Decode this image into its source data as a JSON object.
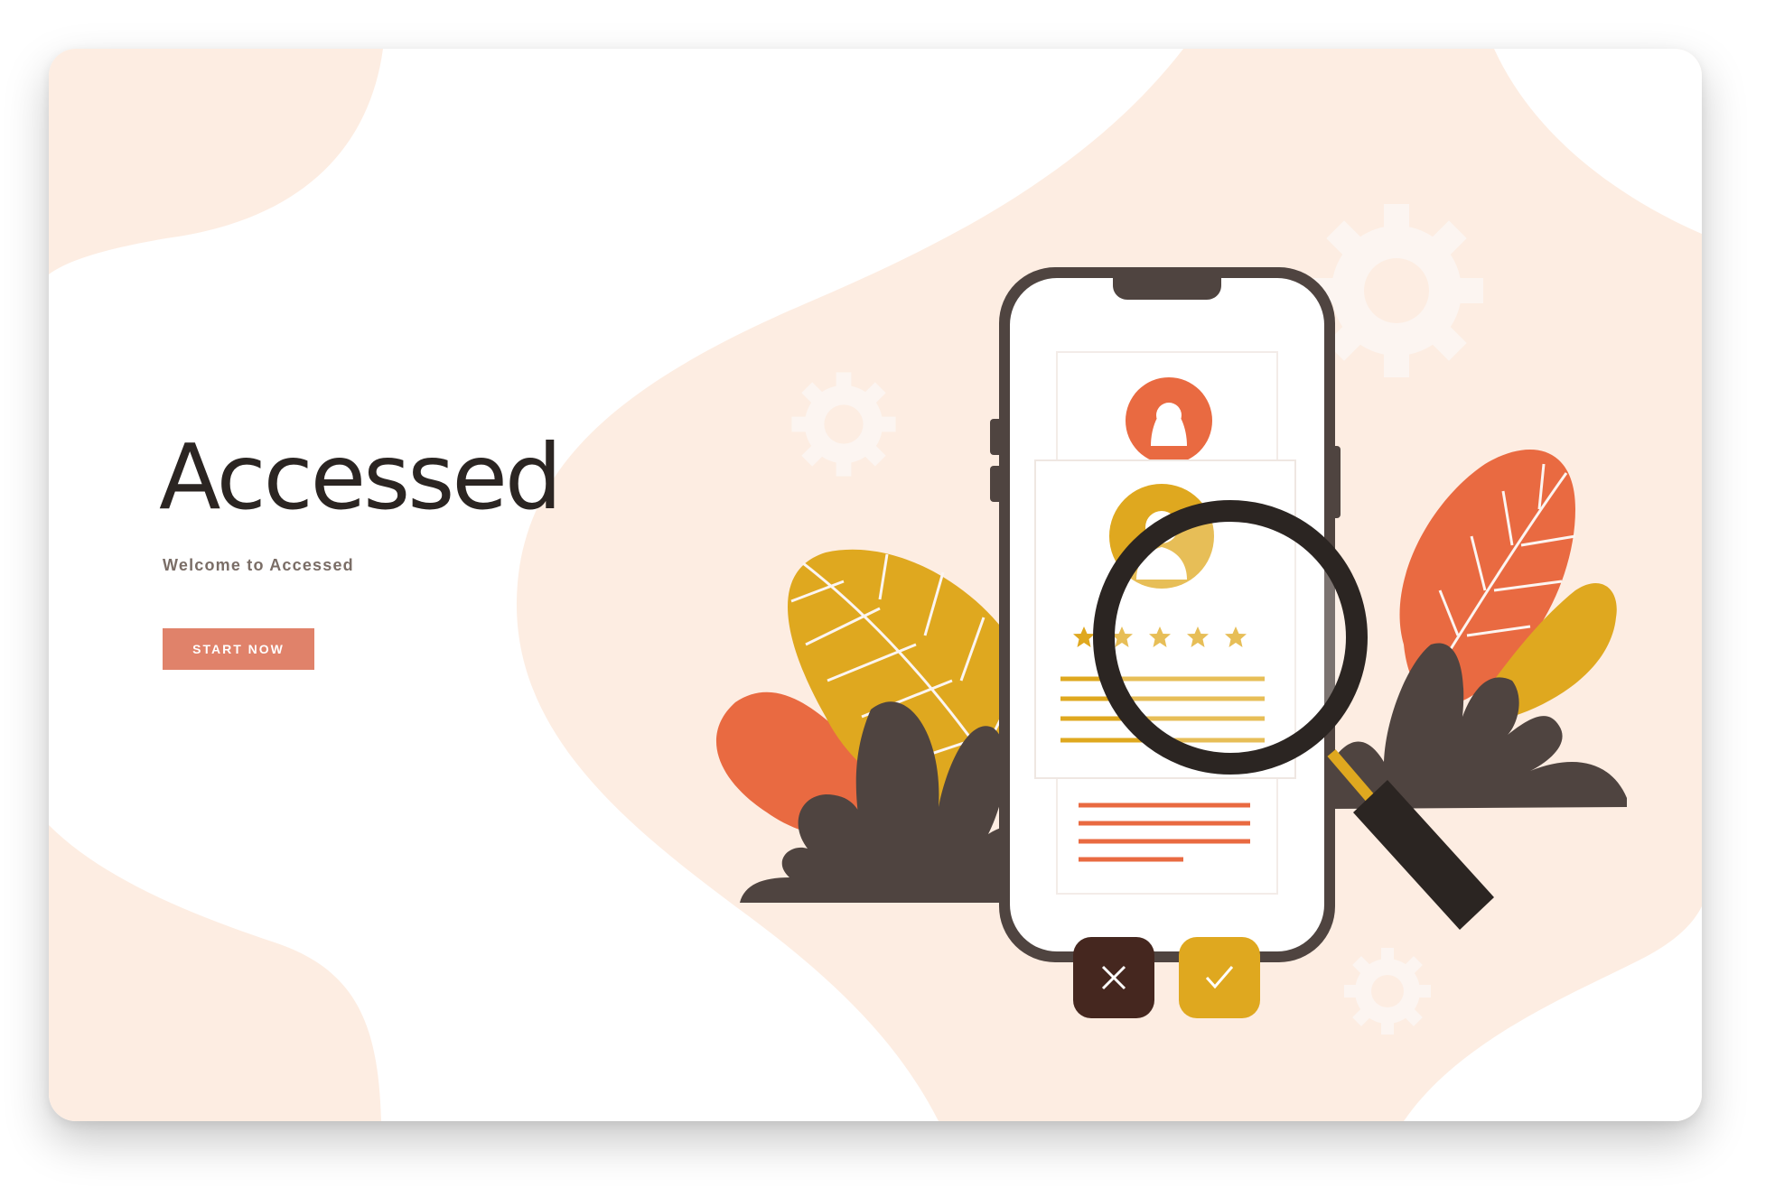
{
  "hero": {
    "title": "Accessed",
    "subtitle": "Welcome to Accessed",
    "cta_label": "START NOW"
  },
  "illustration": {
    "profile_rating_stars": 5,
    "icons": [
      "gear-icon",
      "avatar-icon",
      "star-icon",
      "magnifier-icon",
      "close-icon",
      "check-icon",
      "leaf-icon"
    ]
  },
  "colors": {
    "background_blob": "#fdede2",
    "title_text": "#2b2522",
    "subtitle_text": "#7a6d66",
    "cta": "#e0826a",
    "orange": "#e96a41",
    "mustard": "#dfa81f",
    "dark_brown": "#4f4440",
    "reject": "#45271f",
    "accept": "#dfa81f"
  }
}
